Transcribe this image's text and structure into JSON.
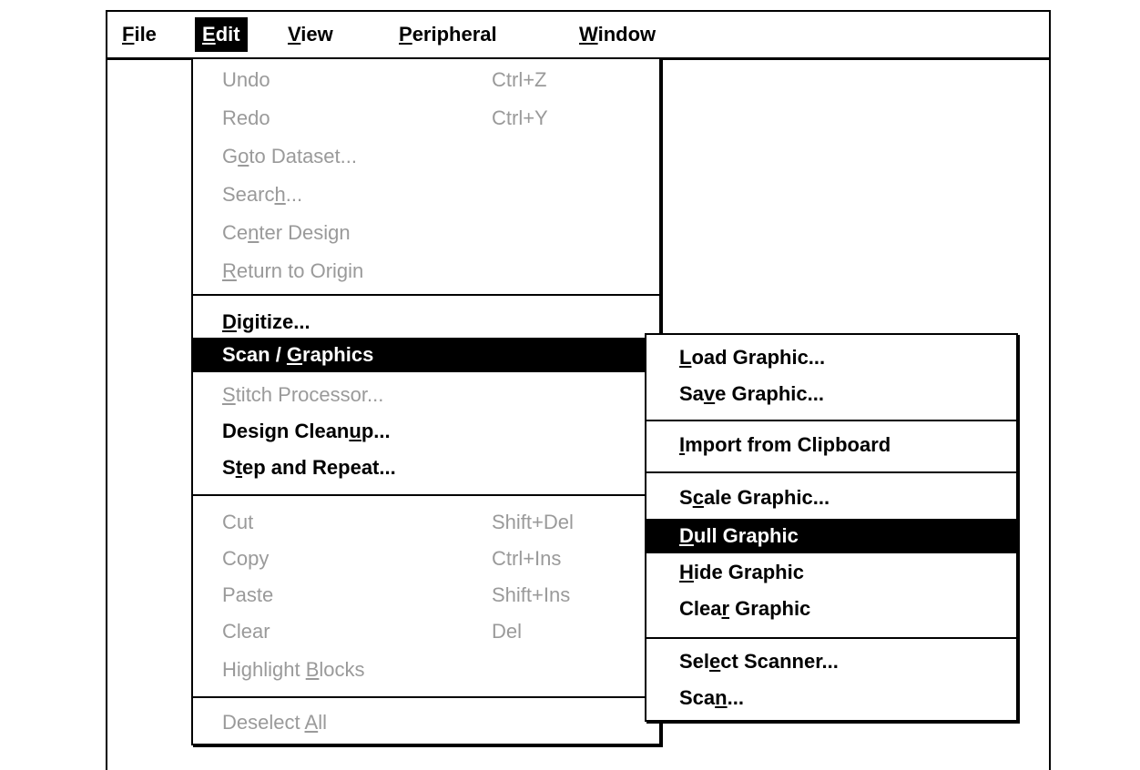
{
  "menubar": {
    "items": [
      {
        "pre": "",
        "key": "F",
        "post": "ile"
      },
      {
        "pre": "",
        "key": "E",
        "post": "dit"
      },
      {
        "pre": "",
        "key": "V",
        "post": "iew"
      },
      {
        "pre": "",
        "key": "P",
        "post": "eripheral"
      },
      {
        "pre": "",
        "key": "W",
        "post": "indow"
      }
    ]
  },
  "edit_menu": {
    "items": [
      {
        "pre": "Undo",
        "key": "",
        "post": "",
        "accel": "Ctrl+Z"
      },
      {
        "pre": "Redo",
        "key": "",
        "post": "",
        "accel": "Ctrl+Y"
      },
      {
        "pre": "G",
        "key": "o",
        "post": "to Dataset...",
        "accel": ""
      },
      {
        "pre": "Searc",
        "key": "h",
        "post": "...",
        "accel": ""
      },
      {
        "pre": "Ce",
        "key": "n",
        "post": "ter Design",
        "accel": ""
      },
      {
        "pre": "",
        "key": "R",
        "post": "eturn to Origin",
        "accel": ""
      },
      {
        "pre": "",
        "key": "D",
        "post": "igitize...",
        "accel": ""
      },
      {
        "pre": "Scan / ",
        "key": "G",
        "post": "raphics",
        "accel": ""
      },
      {
        "pre": "",
        "key": "S",
        "post": "titch Processor...",
        "accel": ""
      },
      {
        "pre": "Design Clean",
        "key": "u",
        "post": "p...",
        "accel": ""
      },
      {
        "pre": "S",
        "key": "t",
        "post": "ep and Repeat...",
        "accel": ""
      },
      {
        "pre": "Cut",
        "key": "",
        "post": "",
        "accel": "Shift+Del"
      },
      {
        "pre": "Copy",
        "key": "",
        "post": "",
        "accel": "Ctrl+Ins"
      },
      {
        "pre": "Paste",
        "key": "",
        "post": "",
        "accel": "Shift+Ins"
      },
      {
        "pre": "Clear",
        "key": "",
        "post": "",
        "accel": "Del"
      },
      {
        "pre": "Highlight ",
        "key": "B",
        "post": "locks",
        "accel": ""
      },
      {
        "pre": "Deselect ",
        "key": "A",
        "post": "ll",
        "accel": ""
      }
    ]
  },
  "graphics_submenu": {
    "items": [
      {
        "pre": "",
        "key": "L",
        "post": "oad Graphic..."
      },
      {
        "pre": "Sa",
        "key": "v",
        "post": "e Graphic..."
      },
      {
        "pre": "",
        "key": "I",
        "post": "mport from Clipboard"
      },
      {
        "pre": "S",
        "key": "c",
        "post": "ale Graphic..."
      },
      {
        "pre": "",
        "key": "D",
        "post": "ull Graphic"
      },
      {
        "pre": "",
        "key": "H",
        "post": "ide Graphic"
      },
      {
        "pre": "Clea",
        "key": "r",
        "post": " Graphic"
      },
      {
        "pre": "Sel",
        "key": "e",
        "post": "ct Scanner..."
      },
      {
        "pre": "Sca",
        "key": "n",
        "post": "..."
      }
    ]
  }
}
